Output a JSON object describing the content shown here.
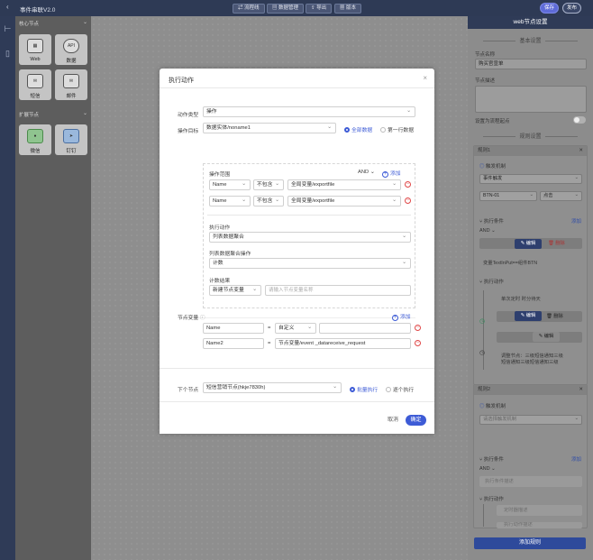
{
  "app": {
    "title": "事件串联V2.0",
    "toolbar": [
      "流程线",
      "数据管理",
      "导出",
      "版本"
    ],
    "save_label": "保存",
    "publish_label": "发布"
  },
  "palette": {
    "core_section": "核心节点",
    "core_nodes": [
      {
        "label": "Web",
        "icon": "web-icon"
      },
      {
        "label": "数据",
        "icon": "api-icon",
        "glyph": "API"
      },
      {
        "label": "短信",
        "icon": "sms-icon"
      },
      {
        "label": "邮件",
        "icon": "mail-icon"
      }
    ],
    "ext_section": "扩展节点",
    "ext_nodes": [
      {
        "label": "微信",
        "icon": "wechat-icon"
      },
      {
        "label": "钉钉",
        "icon": "dingtalk-icon"
      }
    ]
  },
  "right_panel": {
    "title": "web节点设置",
    "basic_section": "基本设置",
    "node_name_label": "节点名称",
    "node_name_value": "购买官宣单",
    "node_desc_label": "节点描述",
    "set_start_label": "设置为流程起点",
    "rule_section": "规则设置",
    "rule1": {
      "header": "规则1",
      "trigger_label": "触发机制",
      "trigger_value": "事件触发",
      "btn_select": "BTN-01",
      "event_select": "点击",
      "cond_label": "执行条件",
      "cond_add": "添加",
      "cond_and": "AND",
      "edit_label": "编辑",
      "delete_label": "删除",
      "cond_text": "变量TextInPut==组件BTN",
      "action_label": "执行动作",
      "action_text": "单次定时 时分待天",
      "edit_label2": "编辑",
      "delete_label2": "删除",
      "edit_label3": "编辑",
      "action_desc": "调整节点：三级短信通知三级短信通知三级短信通知三级"
    },
    "rule2": {
      "header": "规则2",
      "trigger_label": "触发机制",
      "trigger_placeholder": "请选择触发机制",
      "cond_label": "执行条件",
      "cond_add": "添加",
      "cond_and": "AND",
      "cond_placeholder": "执行条件描述",
      "action_label": "执行动作",
      "action_ph1": "定时器描述",
      "action_ph2": "执行动作描述"
    },
    "add_rule_button": "添加规则"
  },
  "modal": {
    "title": "执行动作",
    "action_type_label": "动作类型",
    "action_type_value": "操作",
    "target_label": "操作目标",
    "target_value": "数据实体/noname1",
    "radio_all": "全部数据",
    "radio_first": "第一行数据",
    "scope_label": "操作范围",
    "scope_and": "AND",
    "scope_add": "添加",
    "scope_rows": [
      {
        "field": "Name",
        "op": "不包含",
        "value": "全局变量/exportfile"
      },
      {
        "field": "Name",
        "op": "不包含",
        "value": "全局变量/exportfile"
      }
    ],
    "exec_action_label": "执行动作",
    "exec_action_value": "列表数据聚合",
    "agg_label": "列表数据聚合操作",
    "agg_value": "计数",
    "result_label": "计数结果",
    "result_select": "新建节点变量",
    "result_placeholder": "请输入节点变量名称",
    "node_var_label": "节点变量",
    "node_var_add": "添加",
    "node_vars": [
      {
        "name": "Name",
        "type": "自定义",
        "value": ""
      },
      {
        "name": "Name2",
        "type": "",
        "value": "节点变量/event _datareceive_request"
      }
    ],
    "next_node_label": "下个节点",
    "next_node_value": "短信营销节点(hkje7830h)",
    "radio_batch": "批量执行",
    "radio_each": "逐个执行",
    "cancel_label": "取消",
    "ok_label": "确定"
  }
}
